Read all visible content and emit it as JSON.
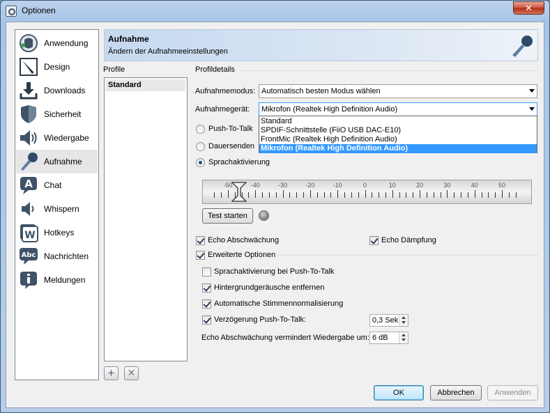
{
  "window": {
    "title": "Optionen",
    "close_glyph": "✕"
  },
  "sidebar": {
    "items": [
      {
        "label": "Anwendung",
        "icon": "teamspeak-logo-icon"
      },
      {
        "label": "Design",
        "icon": "design-icon"
      },
      {
        "label": "Downloads",
        "icon": "download-icon"
      },
      {
        "label": "Sicherheit",
        "icon": "shield-icon"
      },
      {
        "label": "Wiedergabe",
        "icon": "speaker-icon"
      },
      {
        "label": "Aufnahme",
        "icon": "microphone-icon",
        "active": true
      },
      {
        "label": "Chat",
        "icon": "chat-icon"
      },
      {
        "label": "Whispern",
        "icon": "whisper-icon"
      },
      {
        "label": "Hotkeys",
        "icon": "hotkeys-icon"
      },
      {
        "label": "Nachrichten",
        "icon": "messages-icon"
      },
      {
        "label": "Meldungen",
        "icon": "notifications-icon"
      }
    ]
  },
  "header": {
    "title": "Aufnahme",
    "subtitle": "Ändern der Aufnahmeeinstellungen"
  },
  "profile": {
    "heading": "Profile",
    "items": [
      "Standard"
    ],
    "add_glyph": "+",
    "remove_glyph": "✕"
  },
  "details": {
    "heading": "Profildetails",
    "mode_label": "Aufnahmemodus:",
    "mode_value": "Automatisch besten Modus wählen",
    "device_label": "Aufnahmegerät:",
    "device_value": "Mikrofon (Realtek High Definition Audio)",
    "device_options": [
      "Standard",
      "SPDIF-Schnittstelle (FiiO USB DAC-E10)",
      "FrontMic (Realtek High Definition Audio)",
      "Mikrofon (Realtek High Definition Audio)"
    ],
    "device_selected_index": 3,
    "radios": [
      {
        "label": "Push-To-Talk",
        "checked": false
      },
      {
        "label": "Dauersenden",
        "checked": false
      },
      {
        "label": "Sprachaktivierung",
        "checked": true
      }
    ],
    "meter": {
      "tick_labels": [
        "-50",
        "-40",
        "-30",
        "-20",
        "-10",
        "0",
        "10",
        "20",
        "30",
        "40",
        "50"
      ],
      "threshold": -46
    },
    "test_button": "Test starten",
    "echo_reduction": {
      "label": "Echo Abschwächung",
      "checked": true
    },
    "echo_cancel": {
      "label": "Echo Dämpfung",
      "checked": true
    },
    "advanced": {
      "label": "Erweiterte Optionen",
      "checked": true
    },
    "adv_options": [
      {
        "label": "Sprachaktivierung bei Push-To-Talk",
        "checked": false
      },
      {
        "label": "Hintergrundgeräusche entfernen",
        "checked": true
      },
      {
        "label": "Automatische Stimmennormalisierung",
        "checked": true
      },
      {
        "label": "Verzögerung Push-To-Talk:",
        "checked": true
      }
    ],
    "ptt_delay_value": "0,3 Sek",
    "echo_reduce_label": "Echo Abschwächung vermindert Wiedergabe um:",
    "echo_reduce_value": "6 dB"
  },
  "footer": {
    "ok": "OK",
    "cancel": "Abbrechen",
    "apply": "Anwenden"
  }
}
